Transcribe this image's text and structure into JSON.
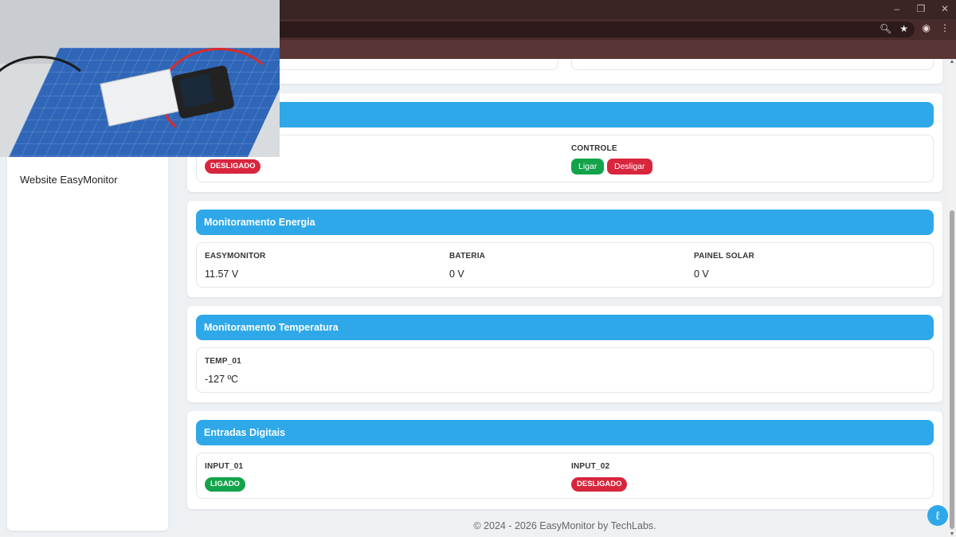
{
  "browser": {
    "window_controls": [
      "–",
      "❐",
      "✕"
    ],
    "colors": {
      "titlebar": "#3a2424",
      "toolbar": "#472b2b"
    }
  },
  "sidebar": {
    "items": [
      {
        "label": "Website EasyMonitor"
      }
    ]
  },
  "sections": {
    "controle": {
      "status_badge": "DESLIGADO",
      "control_label": "CONTROLE",
      "on_button": "Ligar",
      "off_button": "Desligar"
    },
    "energia": {
      "title": "Monitoramento Energia",
      "fields": [
        {
          "label": "EASYMONITOR",
          "value": "11.57 V"
        },
        {
          "label": "BATERIA",
          "value": "0 V"
        },
        {
          "label": "PAINEL SOLAR",
          "value": "0 V"
        }
      ]
    },
    "temperatura": {
      "title": "Monitoramento Temperatura",
      "fields": [
        {
          "label": "TEMP_01",
          "value": "-127 ºC"
        }
      ]
    },
    "entradas": {
      "title": "Entradas Digitais",
      "fields": [
        {
          "label": "INPUT_01",
          "status": "LIGADO"
        },
        {
          "label": "INPUT_02",
          "status": "DESLIGADO"
        }
      ]
    }
  },
  "footer": {
    "text": "© 2024 - 2026 EasyMonitor by TechLabs."
  },
  "theme": {
    "accent": "#2ea8e8",
    "success": "#13a34a",
    "danger": "#d7263d"
  },
  "icons": [
    "zoom-icon",
    "bookmark-star-icon",
    "profile-icon",
    "menu-kebab-icon",
    "chat-icon"
  ]
}
